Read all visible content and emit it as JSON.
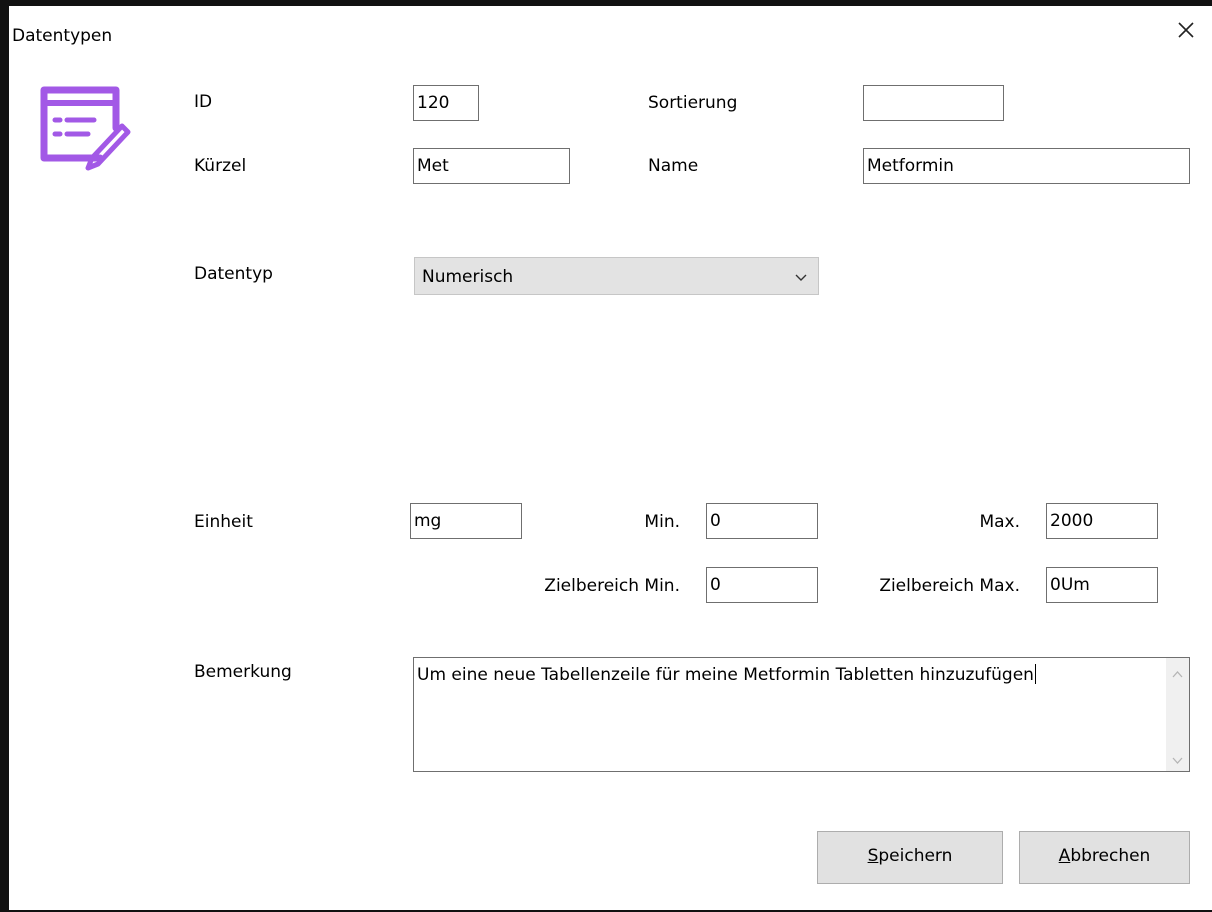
{
  "window": {
    "title": "Datentypen",
    "close_icon": "close-icon",
    "icon": "edit-list-icon",
    "accent_color": "#a259e6"
  },
  "form": {
    "id": {
      "label": "ID",
      "value": "120"
    },
    "sortierung": {
      "label": "Sortierung",
      "value": ""
    },
    "kuerzel": {
      "label": "Kürzel",
      "value": "Met"
    },
    "name": {
      "label": "Name",
      "value": "Metformin"
    },
    "datentyp": {
      "label": "Datentyp",
      "value": "Numerisch"
    },
    "einheit": {
      "label": "Einheit",
      "value": "mg"
    },
    "min": {
      "label": "Min.",
      "value": "0"
    },
    "max": {
      "label": "Max.",
      "value": "2000"
    },
    "ziel_min": {
      "label": "Zielbereich Min.",
      "value": "0"
    },
    "ziel_max": {
      "label": "Zielbereich Max.",
      "value": "0Um"
    },
    "bemerkung": {
      "label": "Bemerkung",
      "value": "Um eine neue Tabellenzeile für meine Metformin Tabletten hinzuzufügen"
    }
  },
  "buttons": {
    "save": {
      "mnemonic": "S",
      "rest": "peichern"
    },
    "cancel": {
      "mnemonic": "A",
      "rest": "bbrechen"
    }
  }
}
